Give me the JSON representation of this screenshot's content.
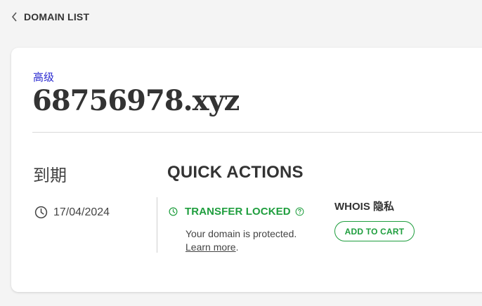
{
  "nav": {
    "back_label": "DOMAIN LIST",
    "back_icon": "chevron-left-icon"
  },
  "domain": {
    "tier": "高级",
    "name": "68756978.xyz"
  },
  "expiry": {
    "label": "到期",
    "date": "17/04/2024",
    "icon": "clock-icon"
  },
  "quick_actions": {
    "title": "QUICK ACTIONS",
    "transfer": {
      "status": "TRANSFER LOCKED",
      "description": "Your domain is protected.",
      "link": "Learn more",
      "link_suffix": ".",
      "icon": "clock-icon",
      "help_icon": "help-circle-icon"
    },
    "whois": {
      "title": "WHOIS 隐私",
      "button": "ADD TO CART"
    }
  },
  "colors": {
    "accent_green": "#1f9e3e",
    "tier_blue": "#2a2ad0",
    "background": "#f4f4f4",
    "card": "#ffffff"
  }
}
